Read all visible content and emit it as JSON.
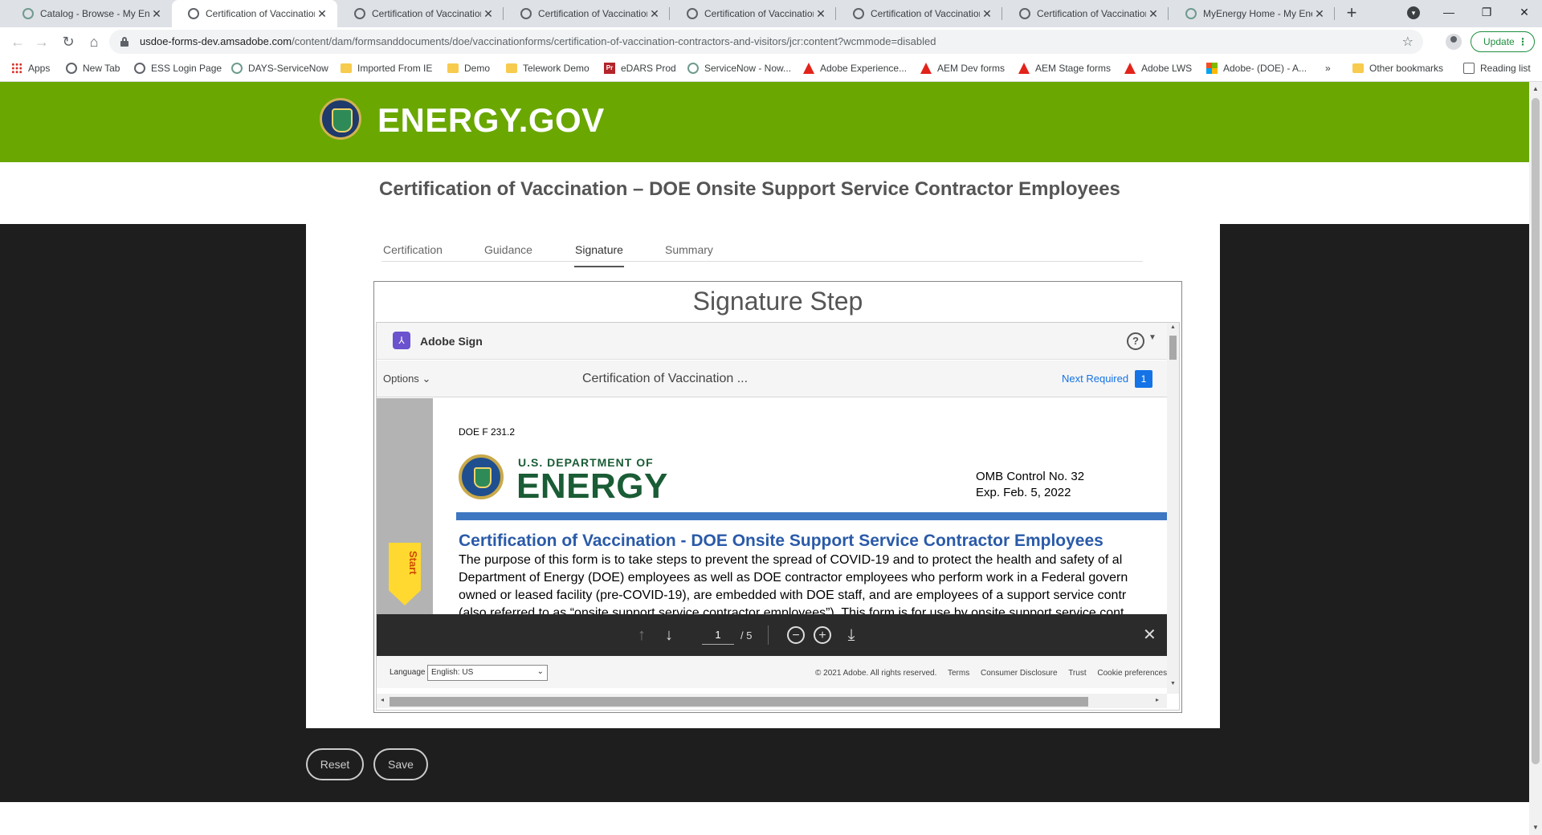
{
  "browser": {
    "tabs": [
      {
        "title": "Catalog - Browse - My Ene",
        "favicon": "ring-icon"
      },
      {
        "title": "Certification of Vaccination",
        "favicon": "globe-icon",
        "active": true
      },
      {
        "title": "Certification of Vaccination",
        "favicon": "globe-icon"
      },
      {
        "title": "Certification of Vaccination",
        "favicon": "globe-icon"
      },
      {
        "title": "Certification of Vaccination",
        "favicon": "globe-icon"
      },
      {
        "title": "Certification of Vaccination",
        "favicon": "globe-icon"
      },
      {
        "title": "Certification of Vaccination",
        "favicon": "globe-icon"
      },
      {
        "title": "MyEnergy Home - My Ene",
        "favicon": "ring-icon"
      }
    ],
    "url_host": "usdoe-forms-dev.amsadobe.com",
    "url_path": "/content/dam/formsanddocuments/doe/vaccinationforms/certification-of-vaccination-contractors-and-visitors/jcr:content?wcmmode=disabled",
    "update_label": "Update",
    "bookmarks": [
      {
        "label": "Apps",
        "icon": "apps-icon"
      },
      {
        "label": "New Tab",
        "icon": "globe-icon"
      },
      {
        "label": "ESS Login Page",
        "icon": "globe-icon"
      },
      {
        "label": "DAYS-ServiceNow",
        "icon": "ring-icon"
      },
      {
        "label": "Imported From IE",
        "icon": "folder-icon"
      },
      {
        "label": "Demo",
        "icon": "folder-icon"
      },
      {
        "label": "Telework Demo",
        "icon": "folder-icon"
      },
      {
        "label": "eDARS Prod",
        "icon": "pr-icon"
      },
      {
        "label": "ServiceNow - Now...",
        "icon": "ring-icon"
      },
      {
        "label": "Adobe Experience...",
        "icon": "adobe-icon"
      },
      {
        "label": "AEM Dev forms",
        "icon": "adobe-icon"
      },
      {
        "label": "AEM Stage forms",
        "icon": "adobe-icon"
      },
      {
        "label": "Adobe LWS",
        "icon": "adobe-icon"
      },
      {
        "label": "Adobe- (DOE) - A...",
        "icon": "msft-icon"
      }
    ],
    "bookmarks_overflow": "»",
    "other_bookmarks": "Other bookmarks",
    "reading_list": "Reading list"
  },
  "site": {
    "title": "ENERGY.GOV",
    "page_heading": "Certification of Vaccination – DOE Onsite Support Service Contractor Employees",
    "tabs": [
      "Certification",
      "Guidance",
      "Signature",
      "Summary"
    ],
    "active_tab": "Signature",
    "signature_step_title": "Signature Step",
    "reset_label": "Reset",
    "save_label": "Save",
    "banner_color": "#6aa700"
  },
  "adobe_sign": {
    "brand": "Adobe Sign",
    "help_symbol": "?",
    "options_label": "Options",
    "doc_name": "Certification of Vaccination ...",
    "next_required_label": "Next Required",
    "next_required_count": "1",
    "start_label": "Start",
    "document": {
      "form_no": "DOE F 231.2",
      "dept_line": "U.S. DEPARTMENT OF",
      "energy_word": "ENERGY",
      "omb_line1": "OMB Control No. 32",
      "omb_line2": "Exp. Feb. 5, 2022",
      "title": "Certification of Vaccination - DOE Onsite Support Service Contractor Employees",
      "body_lines": [
        "The purpose of this form is to take steps to prevent the spread of COVID-19 and to protect the health and safety of al",
        "Department of Energy (DOE) employees as well as DOE contractor employees who perform work in a Federal govern",
        "owned or leased facility (pre-COVID-19), are embedded with DOE staff, and are employees of a support service contr",
        "(also referred to as “onsite support service contractor employees”). This form is for use by onsite support service cont"
      ]
    },
    "pdf_toolbar": {
      "current_page": "1",
      "total_pages": "/ 5"
    },
    "footer": {
      "language_label": "Language",
      "language_value": "English: US",
      "copyright": "© 2021 Adobe. All rights reserved.",
      "links": [
        "Terms",
        "Consumer Disclosure",
        "Trust",
        "Cookie preferences"
      ]
    }
  }
}
